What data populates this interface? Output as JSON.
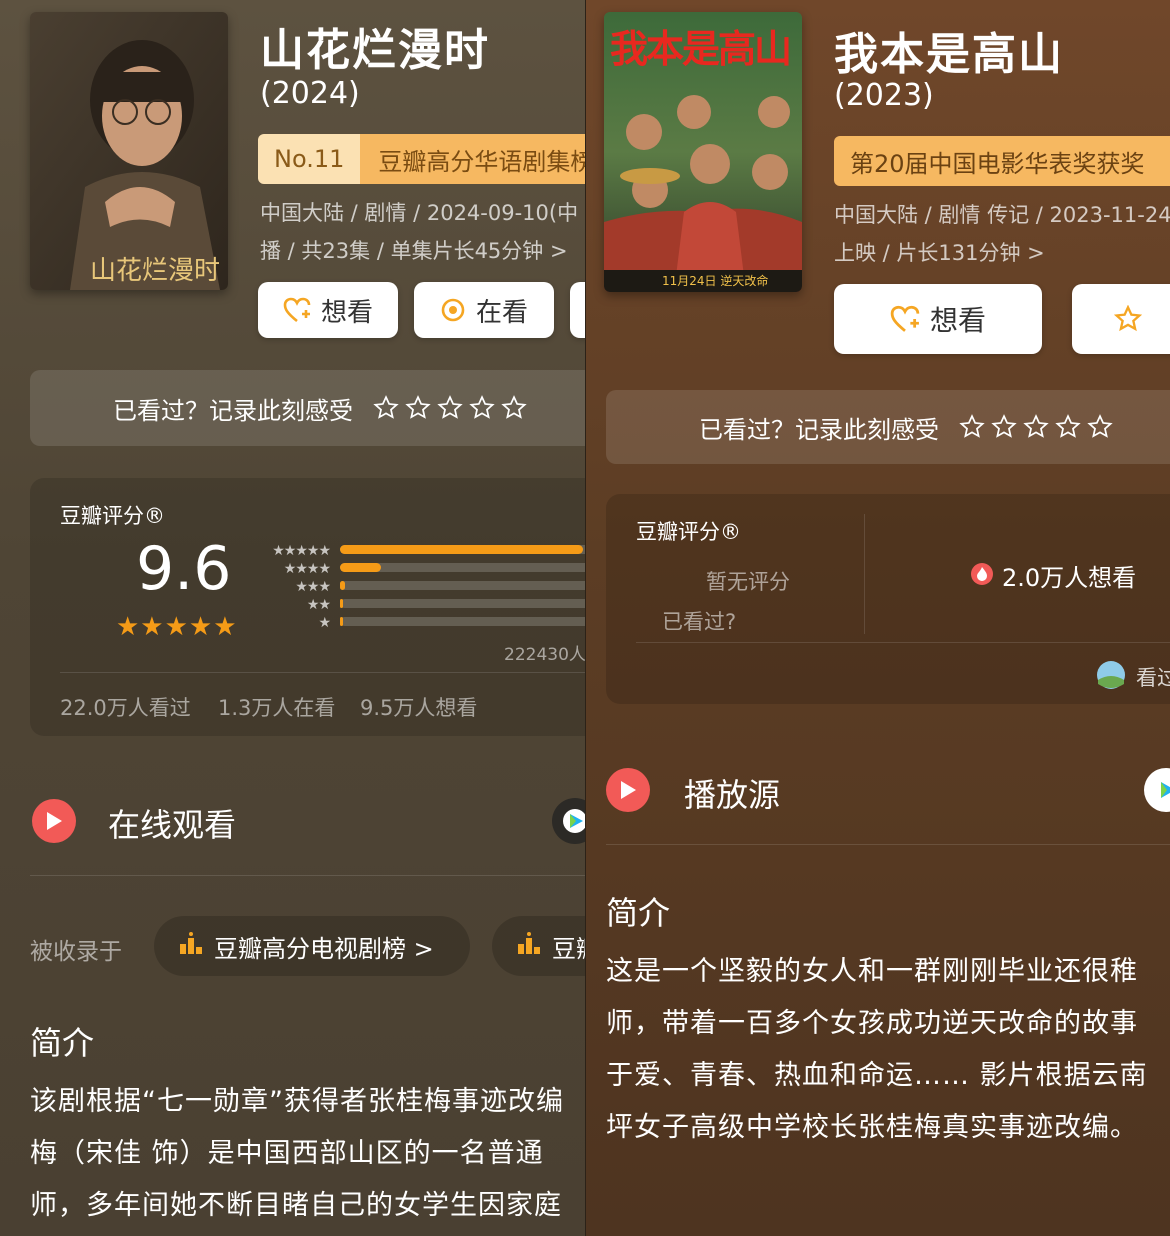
{
  "left": {
    "title": "山花烂漫时",
    "poster_text": "山花烂漫时",
    "year": "(2024)",
    "rank_no": "No.11",
    "rank_label": "豆瓣高分华语剧集榜",
    "meta_line1": "中国大陆 / 剧情 / 2024-09-10(中",
    "meta_line2": "播 / 共23集 / 单集片长45分钟 >",
    "btn_want": "想看",
    "btn_watching": "在看",
    "record_text": "已看过？记录此刻感受",
    "rating_label": "豆瓣评分®",
    "score": "9.6",
    "score_stars": "★★★★★",
    "distribution": [
      0.9,
      0.15,
      0.02,
      0.01,
      0.01
    ],
    "rating_count": "222430人",
    "stats": [
      "22.0万人看过",
      "1.3万人在看",
      "9.5万人想看"
    ],
    "watch_title": "在线观看",
    "collected_label": "被收录于",
    "chip1": "豆瓣高分电视剧榜 >",
    "chip2": "豆瓣",
    "intro_title": "简介",
    "intro_lines": [
      "该剧根据“七一勋章”获得者张桂梅事迹改编",
      "梅（宋佳 饰）是中国西部山区的一名普通",
      "师，多年间她不断目睹自己的女学生因家庭"
    ]
  },
  "right": {
    "title": "我本是高山",
    "poster_text": "我本是高山",
    "poster_date": "11月24日 逆天改命",
    "year": "(2023)",
    "award": "第20届中国电影华表奖获奖",
    "meta_line1": "中国大陆 / 剧情 传记 / 2023-11-24",
    "meta_line2": "上映 / 片长131分钟 >",
    "btn_want": "想看",
    "record_text": "已看过？记录此刻感受",
    "rating_label": "豆瓣评分®",
    "no_score": "暂无评分",
    "seen": "已看过?",
    "wanting": "2.0万人想看",
    "seen_more": "看过",
    "source_title": "播放源",
    "intro_title": "简介",
    "intro_lines": [
      "这是一个坚毅的女人和一群刚刚毕业还很稚",
      "师，带着一百多个女孩成功逆天改命的故事",
      "于爱、青春、热血和命运…… 影片根据云南",
      "坪女子高级中学校长张桂梅真实事迹改编。"
    ]
  },
  "colors": {
    "accent": "#f59b17",
    "play": "#f25a57",
    "rank": "#f6b861"
  }
}
